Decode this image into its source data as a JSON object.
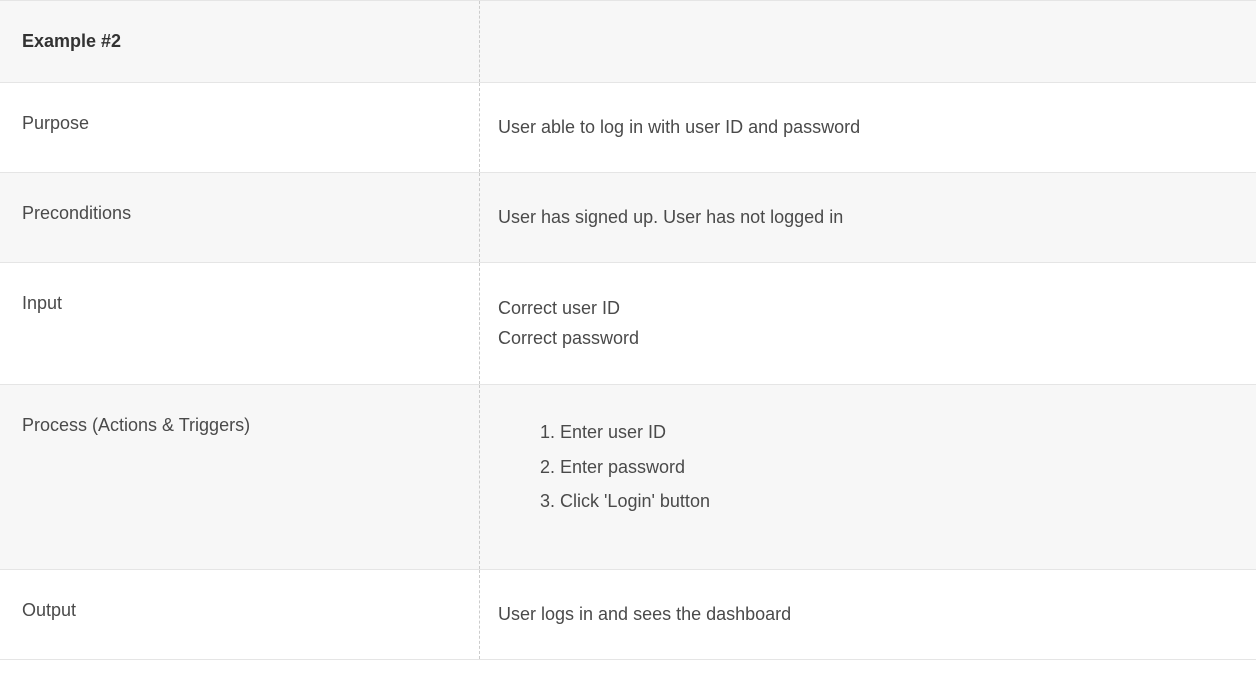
{
  "table": {
    "header": {
      "title": "Example #2"
    },
    "rows": {
      "purpose": {
        "label": "Purpose",
        "value": "User able to log in with user ID and password"
      },
      "preconditions": {
        "label": "Preconditions",
        "value": "User has signed up. User has not logged in"
      },
      "input": {
        "label": "Input",
        "lines": [
          "Correct user ID",
          "Correct password"
        ]
      },
      "process": {
        "label": "Process (Actions & Triggers)",
        "steps": [
          "Enter user ID",
          "Enter password",
          "Click 'Login' button"
        ]
      },
      "output": {
        "label": "Output",
        "value": "User logs in and sees the dashboard"
      }
    }
  }
}
